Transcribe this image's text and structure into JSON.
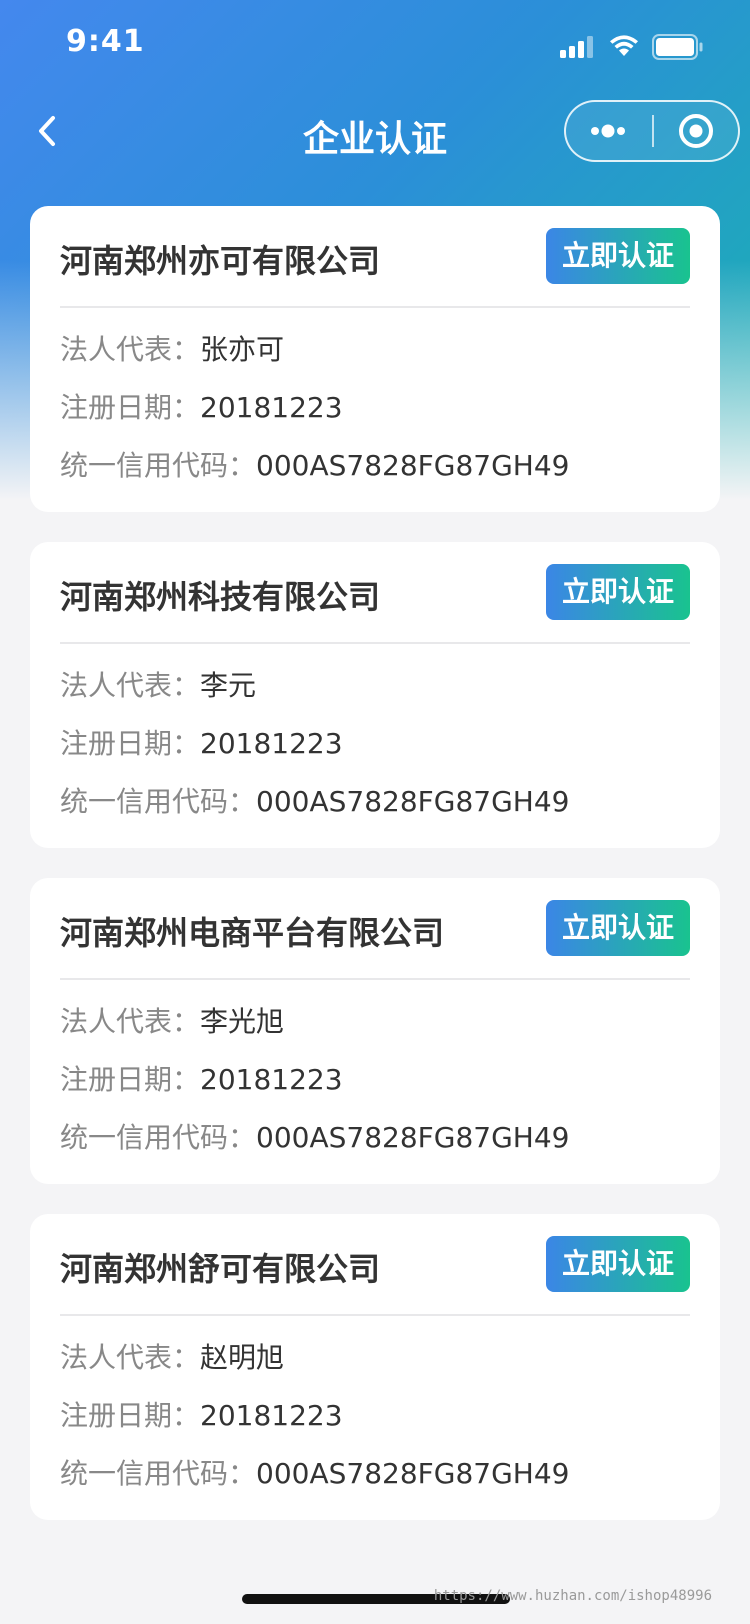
{
  "status_bar": {
    "time": "9:41",
    "icons": [
      "signal-icon",
      "wifi-icon",
      "battery-icon"
    ]
  },
  "nav": {
    "back_icon": "chevron-left-icon",
    "title": "企业认证",
    "capsule_icons": [
      "more-dots-icon",
      "close-circle-icon"
    ]
  },
  "labels": {
    "legal_rep": "法人代表：",
    "reg_date": "注册日期：",
    "credit_code": "统一信用代码："
  },
  "companies": [
    {
      "name": "河南郑州亦可有限公司",
      "button_label": "立即认证",
      "legal_rep": "张亦可",
      "reg_date": "20181223",
      "credit_code": "000AS7828FG87GH49"
    },
    {
      "name": "河南郑州科技有限公司",
      "button_label": "立即认证",
      "legal_rep": "李元",
      "reg_date": "20181223",
      "credit_code": "000AS7828FG87GH49"
    },
    {
      "name": "河南郑州电商平台有限公司",
      "button_label": "立即认证",
      "legal_rep": "李光旭",
      "reg_date": "20181223",
      "credit_code": "000AS7828FG87GH49"
    },
    {
      "name": "河南郑州舒可有限公司",
      "button_label": "立即认证",
      "legal_rep": "赵明旭",
      "reg_date": "20181223",
      "credit_code": "000AS7828FG87GH49"
    }
  ],
  "watermark": "https://www.huzhan.com/ishop48996",
  "colors": {
    "header_gradient_start": "#4488ee",
    "header_gradient_end": "#1ab3b0",
    "button_gradient_start": "#3b86e6",
    "button_gradient_end": "#19c38f",
    "background": "#f4f4f6"
  }
}
